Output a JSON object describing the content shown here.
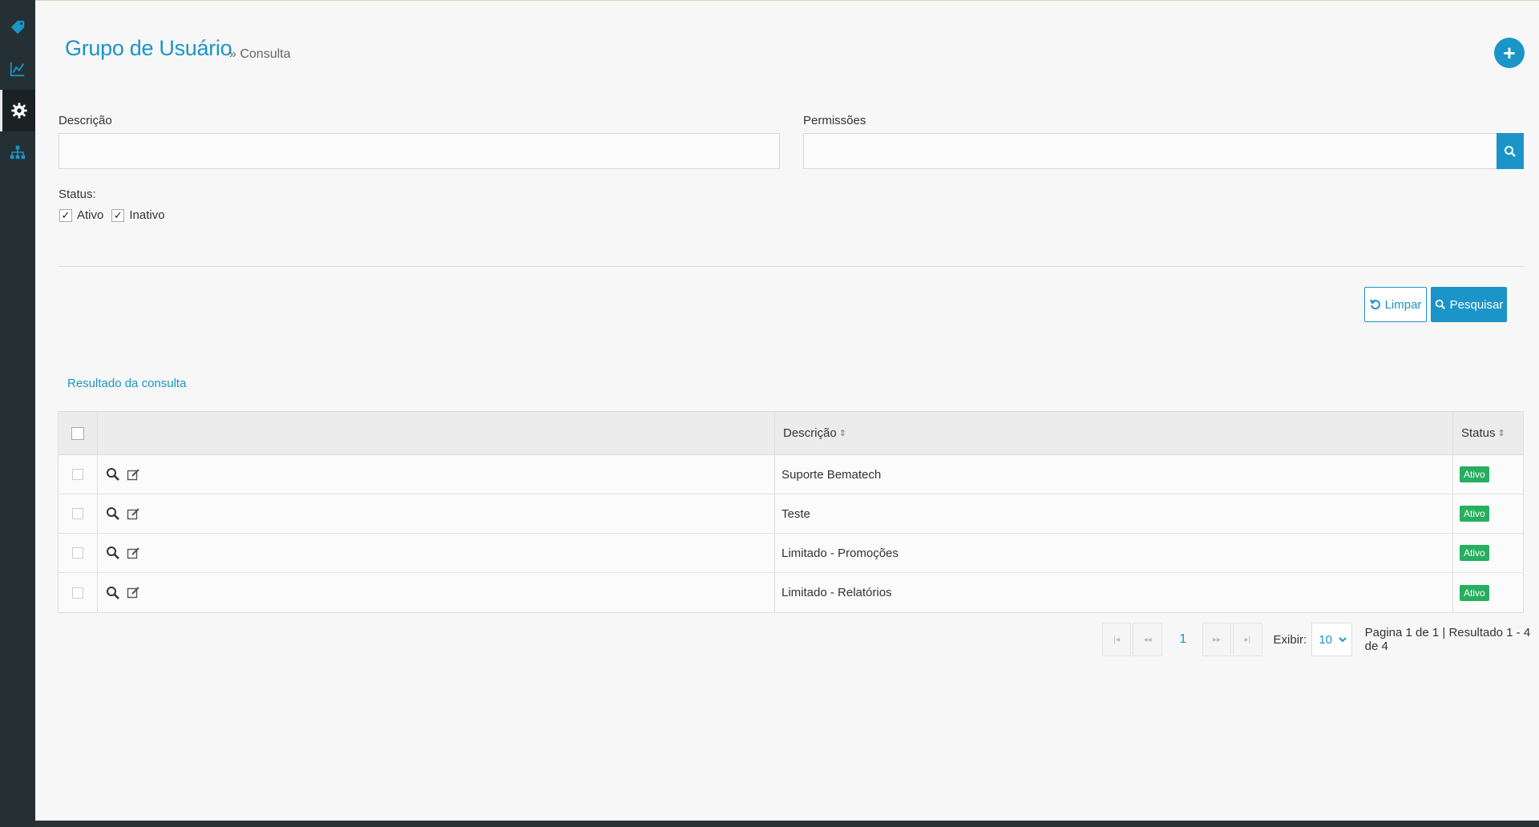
{
  "sidebar": {
    "items": [
      {
        "icon": "tag-icon"
      },
      {
        "icon": "chart-line-icon"
      },
      {
        "icon": "gear-icon"
      },
      {
        "icon": "sitemap-icon"
      }
    ]
  },
  "header": {
    "title": "Grupo de Usuário",
    "breadcrumb": "» Consulta"
  },
  "filters": {
    "descricao_label": "Descrição",
    "descricao_value": "",
    "permissoes_label": "Permissões",
    "permissoes_value": "",
    "status_label": "Status:",
    "status_options": [
      {
        "label": "Ativo",
        "checked": true
      },
      {
        "label": "Inativo",
        "checked": true
      }
    ]
  },
  "actions": {
    "limpar_label": "Limpar",
    "pesquisar_label": "Pesquisar"
  },
  "results": {
    "title": "Resultado da consulta",
    "columns": {
      "descricao": "Descrição",
      "status": "Status"
    },
    "rows": [
      {
        "descricao": "Suporte Bematech",
        "status": "Ativo"
      },
      {
        "descricao": "Teste",
        "status": "Ativo"
      },
      {
        "descricao": "Limitado - Promoções",
        "status": "Ativo"
      },
      {
        "descricao": "Limitado - Relatórios",
        "status": "Ativo"
      }
    ]
  },
  "pagination": {
    "current_page": "1",
    "exibir_label": "Exibir:",
    "exibir_value": "10",
    "info": "Pagina 1 de 1 | Resultado 1 - 4 de 4"
  },
  "colors": {
    "accent": "#1b95c8",
    "status_active": "#27ae60",
    "sidebar": "#253035"
  }
}
